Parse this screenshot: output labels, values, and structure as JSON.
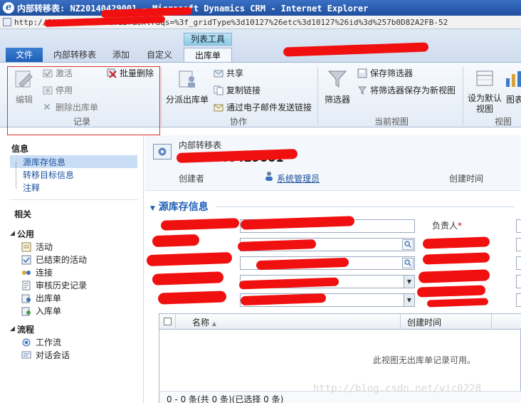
{
  "window": {
    "title": "内部转移表: NZ20140429001 - Microsoft Dynamics CRM - Internet Explorer",
    "address": "http://1924... ?etc=10127&extraqs=%3f_gridType%3d10127%26etc%3d10127%26id%3d%257b0D82A2FB-52"
  },
  "ribbon": {
    "contextual_group": "列表工具",
    "tabs": [
      "文件",
      "内部转移表",
      "添加",
      "自定义",
      "出库单"
    ],
    "groups": {
      "records": {
        "label": "记录",
        "edit": "编辑",
        "activate": "激活",
        "deactivate": "停用",
        "bulk_delete": "批量删除",
        "delete": "删除出库单"
      },
      "collaborate": {
        "label": "协作",
        "assign": "分派出库单",
        "share": "共享",
        "copy_link": "复制链接",
        "email_link": "通过电子邮件发送链接"
      },
      "current_view": {
        "label": "当前视图",
        "filter": "筛选器",
        "save_filter": "保存筛选器",
        "save_filter_as_view": "将筛选器保存为新视图"
      },
      "view": {
        "label": "视图",
        "set_default": "设为默认视图",
        "chart": "图表"
      }
    }
  },
  "nav": {
    "info_header": "信息",
    "info_items": [
      "源库存信息",
      "转移目标信息",
      "注释"
    ],
    "related_header": "相关",
    "common_header": "公用",
    "common_items": [
      "活动",
      "已结束的活动",
      "连接",
      "审核历史记录",
      "出库单",
      "入库单"
    ],
    "process_header": "流程",
    "process_items": [
      "工作流",
      "对话会话"
    ]
  },
  "form": {
    "entity_type": "内部转移表",
    "record_name": "NZ20140429001",
    "owner_label": "创建者",
    "owner_value": "系统管理员",
    "created_on_label": "创建时间",
    "section_title": "源库存信息",
    "owner_field_label": "负责人",
    "required_mark": "*"
  },
  "subgrid": {
    "col_name": "名称",
    "col_created": "创建时间",
    "empty_message": "此视图无出库单记录可用。",
    "footer": "0 - 0 条(共 0 条)(已选择 0 条)"
  },
  "watermark": "http://blog.csdn.net/vic0228"
}
